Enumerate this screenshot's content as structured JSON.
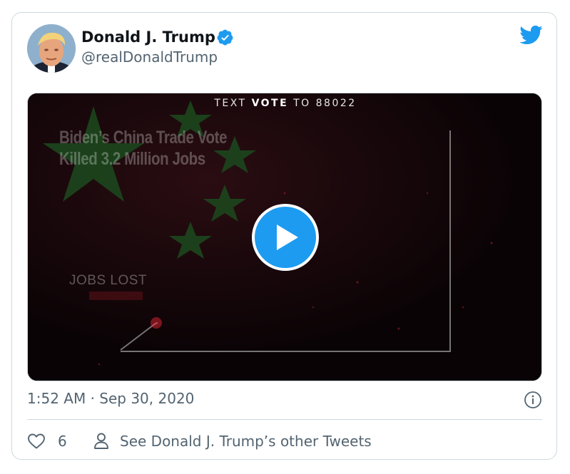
{
  "tweet": {
    "author": {
      "display_name": "Donald J. Trump",
      "handle": "@realDonaldTrump",
      "verified": true,
      "avatar_icon": "profile-photo"
    },
    "timestamp": "1:52 AM · Sep 30, 2020",
    "brand_icon": "twitter-bird-icon",
    "info_icon": "info-icon"
  },
  "media": {
    "type": "video",
    "overlay_text_prefix": "TEXT ",
    "overlay_text_bold": "VOTE",
    "overlay_text_suffix": " TO 88022",
    "headline_line1": "Biden’s China Trade Vote",
    "headline_line2": "Killed 3.2 Million Jobs",
    "chart_label": "JOBS LOST",
    "play_icon": "play-icon"
  },
  "actions": {
    "like_count": "6",
    "other_tweets_label": "See Donald J. Trump’s other Tweets"
  },
  "colors": {
    "accent": "#1d9bf0",
    "text_primary": "#0f1419",
    "text_secondary": "#536471",
    "border": "#cfd9de",
    "media_bg": "#0d0507"
  }
}
